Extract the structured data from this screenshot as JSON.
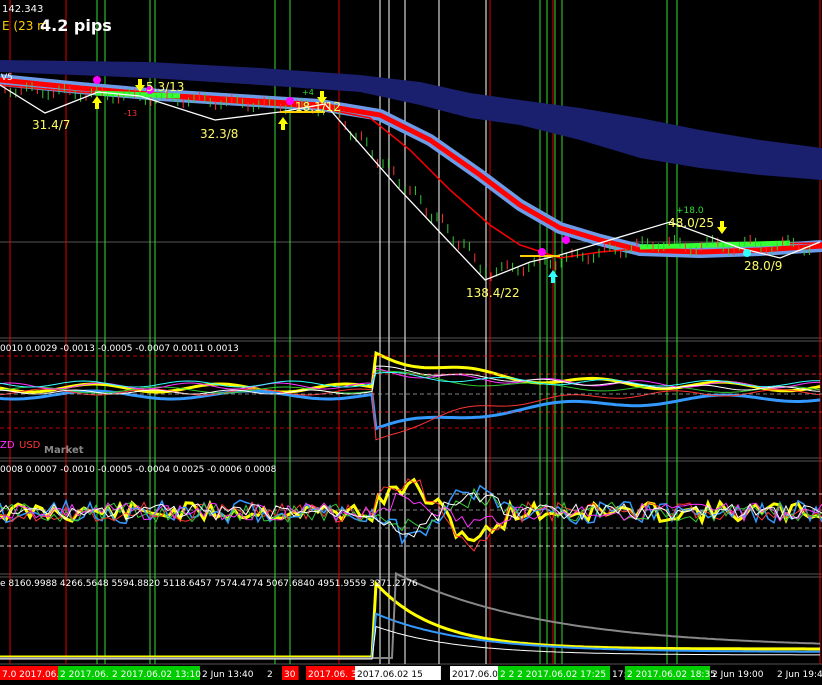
{
  "header": {
    "price_label": "142.343",
    "indicator_label": "E (23 m",
    "pips_label": "4.2 pips",
    "price_scale_label": "V5"
  },
  "trades": [
    {
      "label": "31.4/7"
    },
    {
      "label": "5.3/13"
    },
    {
      "label": "32.3/8"
    },
    {
      "label": "18.1/12"
    },
    {
      "label": "138.4/22"
    },
    {
      "label": "48.0/25"
    },
    {
      "label": "28.0/9"
    }
  ],
  "small_labels": [
    "+4",
    "-13",
    "+18.0"
  ],
  "sub1": {
    "values_line": "0010 0.0029 -0.0013 -0.0005 -0.0007 0.0011 0.0013",
    "currency_a": "ZD",
    "currency_b": "USD",
    "market_label": "Market"
  },
  "sub2": {
    "values_line": "0008 0.0007 -0.0010 -0.0005 -0.0004 0.0025 -0.0006 0.0008"
  },
  "sub3": {
    "values_line": "e  8160.9988  4266.5648  5594.8820  5118.6457  7574.4774  5067.6840  4951.9559  3271.2776"
  },
  "time_axis": [
    {
      "label": "7.0 2017.06.0",
      "bg": "#ff0000",
      "fg": "#ffffff"
    },
    {
      "label": "2 2017.06.",
      "bg": "#00cc00",
      "fg": "#ffffff"
    },
    {
      "label": "2 2017.06.02 13:10",
      "bg": "#00cc00",
      "fg": "#ffffff"
    },
    {
      "label": "2 Jun 13:40",
      "bg": "",
      "fg": "#ffffff"
    },
    {
      "label": "2",
      "bg": "",
      "fg": "#ffffff"
    },
    {
      "label": "30",
      "bg": "#ff0000",
      "fg": "#ffffff"
    },
    {
      "label": "2017.06. 30",
      "bg": "#ff0000",
      "fg": "#ffffff"
    },
    {
      "label": "2017.06.02 15",
      "bg": "#ffffff",
      "fg": "#000000"
    },
    {
      "label": "2017.06.02",
      "bg": "#ffffff",
      "fg": "#000000"
    },
    {
      "label": "2 2 2 2017.06.02 17:25",
      "bg": "#00cc00",
      "fg": "#ffffff"
    },
    {
      "label": "17:4",
      "bg": "",
      "fg": "#ffffff"
    },
    {
      "label": "2 2017.06.02 18:35",
      "bg": "#00cc00",
      "fg": "#ffffff"
    },
    {
      "label": "2 Jun 19:00",
      "bg": "",
      "fg": "#ffffff"
    },
    {
      "label": "2 Jun 19:40",
      "bg": "",
      "fg": "#ffffff"
    }
  ],
  "colors": {
    "background": "#000000",
    "cloud": "#1a1f6e",
    "fast_band": "#ff0000",
    "slow_band": "#6c9be8",
    "signal_buy": "#ffff00",
    "signal_sell": "#ff00ff",
    "trade_line": "#ffffff",
    "trade_text": "#ffff66",
    "v_red": "#e00000",
    "v_green": "#33dd33",
    "v_white": "#ffffff"
  }
}
